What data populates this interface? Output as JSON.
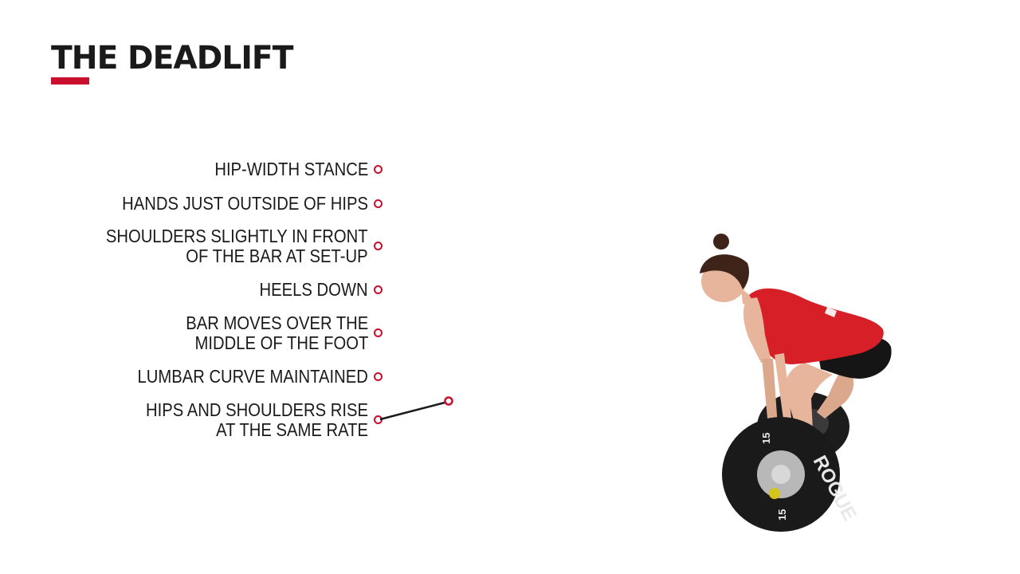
{
  "title": "THE DEADLIFT",
  "accent_color": "#c8102e",
  "cues": [
    {
      "lines": [
        "HIP-WIDTH STANCE"
      ]
    },
    {
      "lines": [
        "HANDS JUST OUTSIDE OF HIPS"
      ]
    },
    {
      "lines": [
        "SHOULDERS SLIGHTLY IN FRONT",
        "OF THE BAR AT SET-UP"
      ]
    },
    {
      "lines": [
        "HEELS DOWN"
      ]
    },
    {
      "lines": [
        "BAR MOVES OVER THE",
        "MIDDLE OF THE FOOT"
      ]
    },
    {
      "lines": [
        "LUMBAR CURVE MAINTAINED"
      ]
    },
    {
      "lines": [
        "HIPS AND SHOULDERS RISE",
        "AT THE SAME RATE"
      ]
    }
  ],
  "plate": {
    "brand": "ROGUE",
    "weight": "15"
  }
}
